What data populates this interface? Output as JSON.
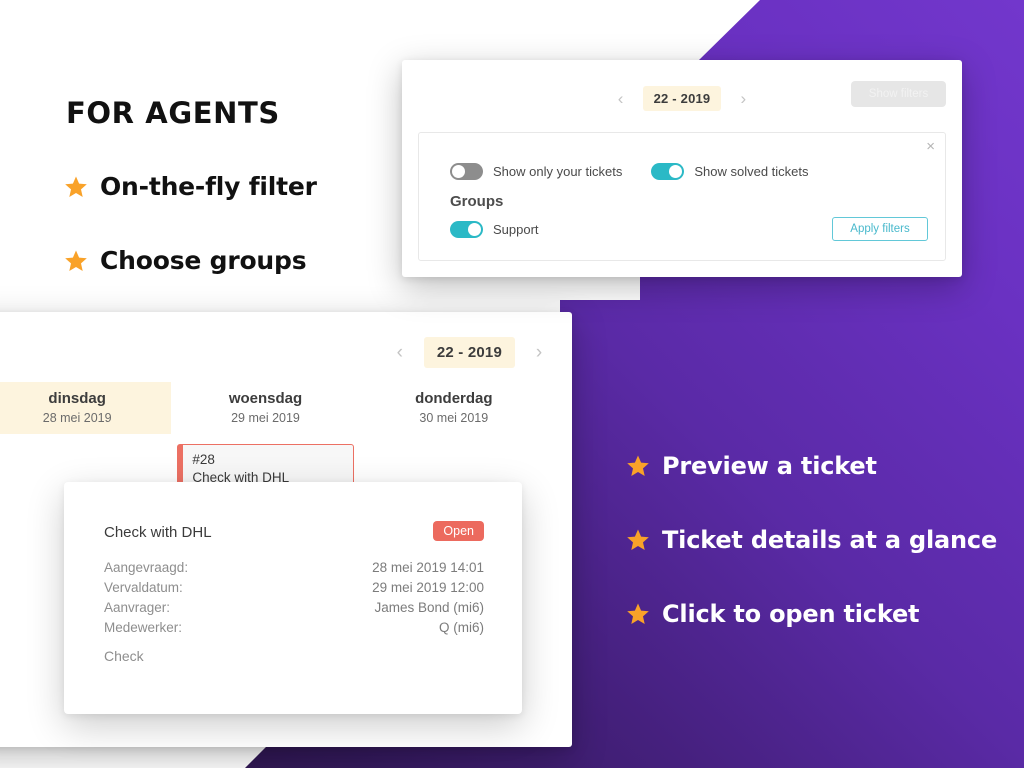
{
  "left_panel": {
    "headline": "FOR AGENTS",
    "bullets": [
      {
        "icon": "star-icon",
        "label": "On-the-fly filter"
      },
      {
        "icon": "star-icon",
        "label": "Choose groups"
      }
    ]
  },
  "right_panel": {
    "bullets": [
      {
        "icon": "star-icon",
        "label": "Preview a ticket"
      },
      {
        "icon": "star-icon",
        "label": "Ticket details at a glance"
      },
      {
        "icon": "star-icon",
        "label": "Click to open ticket"
      }
    ]
  },
  "filters_card": {
    "week_nav": {
      "prev_icon": "chevron-left-icon",
      "next_icon": "chevron-right-icon",
      "prev_label": "‹",
      "next_label": "›",
      "value": "22 - 2019"
    },
    "show_filters_label": "Show filters",
    "panel": {
      "close_icon": "close-icon",
      "close_label": "×",
      "toggles": [
        {
          "label": "Show only your tickets",
          "state": "off"
        },
        {
          "label": "Show solved tickets",
          "state": "on"
        }
      ],
      "groups_title": "Groups",
      "groups": [
        {
          "label": "Support",
          "state": "on"
        }
      ],
      "apply_label": "Apply filters"
    }
  },
  "calendar_card": {
    "week_nav": {
      "prev_label": "‹",
      "next_label": "›",
      "value": "22 - 2019"
    },
    "days": [
      {
        "name": "dinsdag",
        "date": "28 mei 2019",
        "today": true,
        "tickets": []
      },
      {
        "name": "woensdag",
        "date": "29 mei 2019",
        "today": false,
        "tickets": [
          {
            "id": "#28",
            "title": "Check with DHL"
          },
          {
            "id": "",
            "title": ""
          }
        ]
      },
      {
        "name": "donderdag",
        "date": "30 mei 2019",
        "today": false,
        "tickets": []
      }
    ]
  },
  "ticket_popover": {
    "title": "Check with DHL",
    "status": "Open",
    "fields": [
      {
        "label": "Aangevraagd:",
        "value": "28 mei 2019 14:01"
      },
      {
        "label": "Vervaldatum:",
        "value": "29 mei 2019 12:00"
      },
      {
        "label": "Aanvrager:",
        "value": "James Bond (mi6)"
      },
      {
        "label": "Medewerker:",
        "value": "Q (mi6)"
      }
    ],
    "body": "Check"
  },
  "colors": {
    "star": "#f9a229",
    "teal": "#2bb9c6",
    "open_badge": "#ec6a5e",
    "ticket_border": "#ec7063",
    "pill_bg": "#fdf4de",
    "purple_light": "#7237cc",
    "purple_dark": "#2a1542"
  }
}
